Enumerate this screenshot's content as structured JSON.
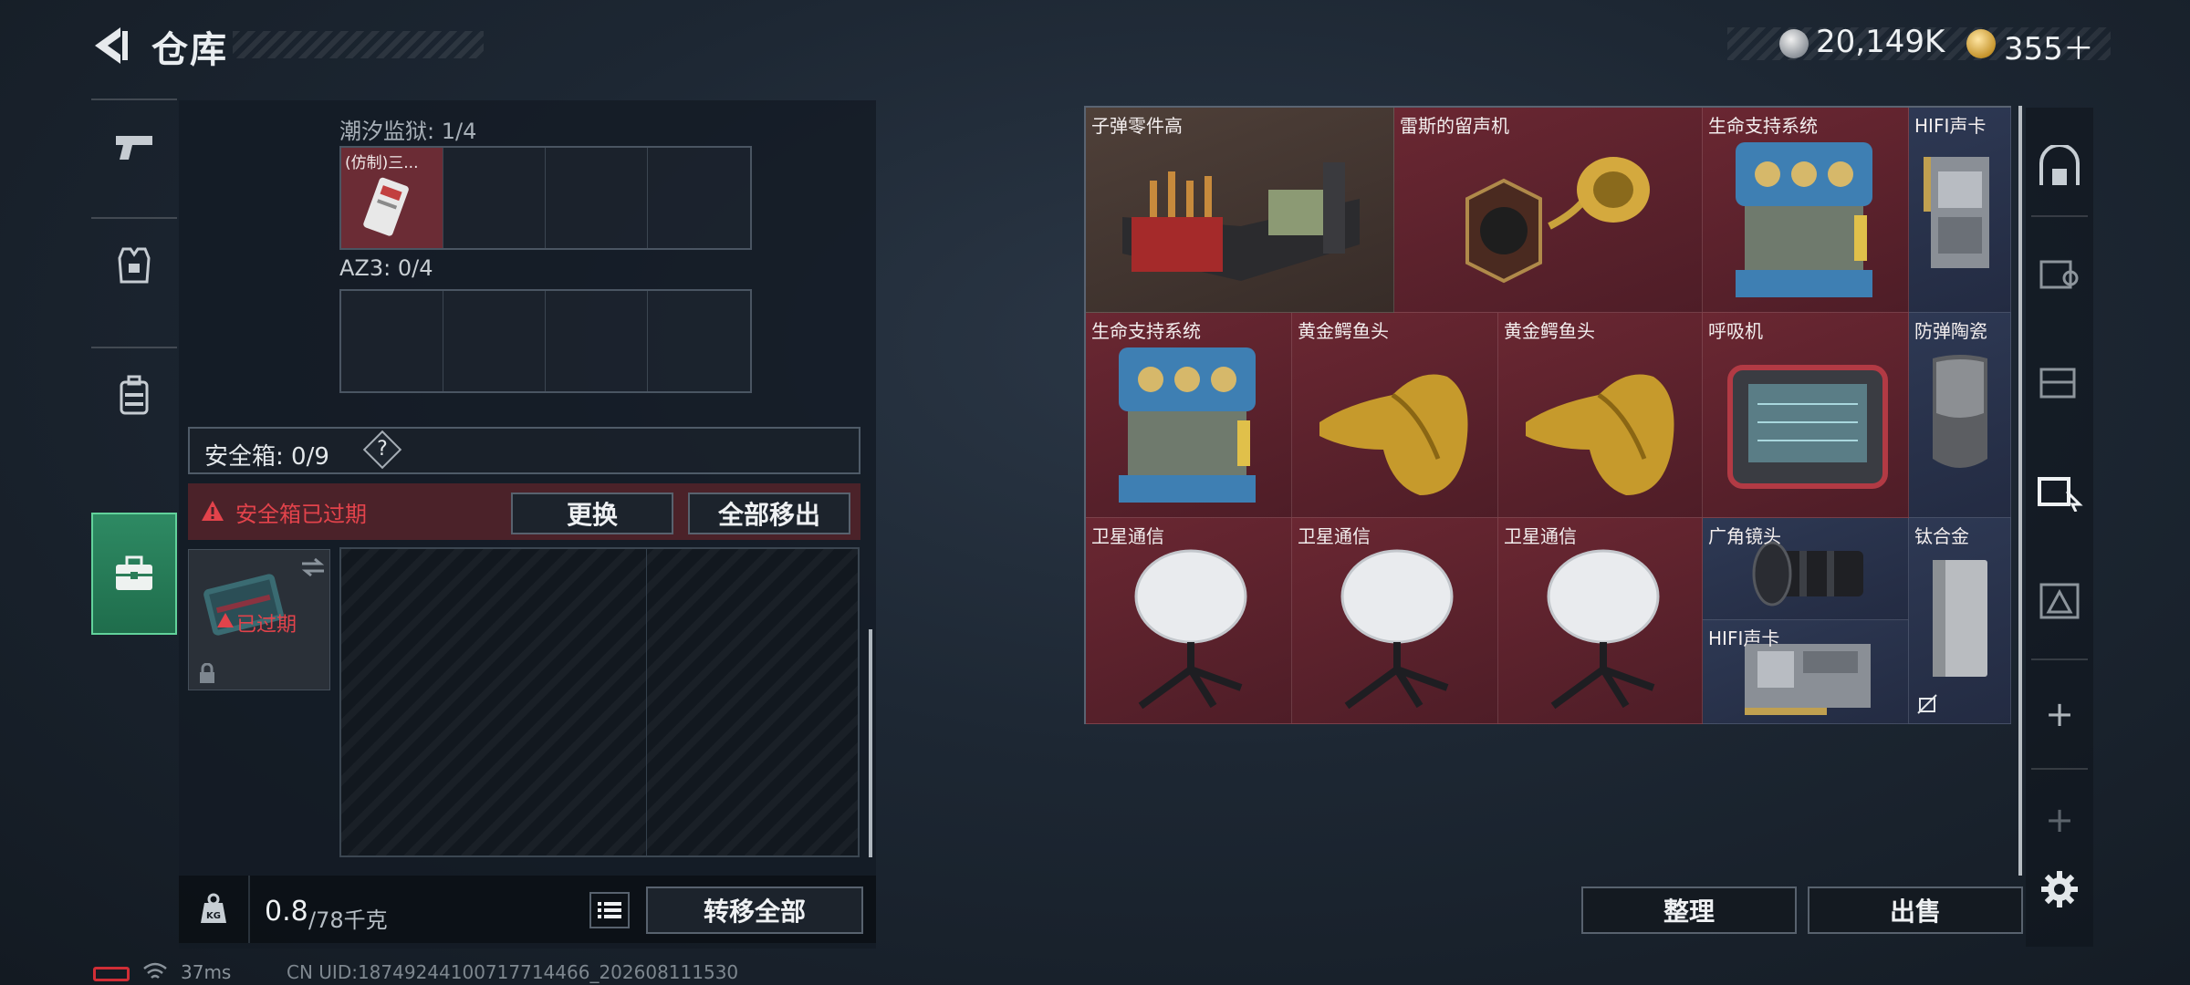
{
  "header": {
    "title": "仓库",
    "currency": [
      {
        "icon": "silver-coin-icon",
        "value": "20,149K"
      },
      {
        "icon": "gold-coin-icon",
        "value": "355＋"
      }
    ]
  },
  "left_tabs": [
    {
      "icon": "pistol-icon",
      "active": false
    },
    {
      "icon": "armor-vest-icon",
      "active": false
    },
    {
      "icon": "backpack-icon",
      "active": false
    },
    {
      "icon": "toolbox-icon",
      "active": true
    }
  ],
  "containers": {
    "tide_prison": {
      "label": "潮汐监狱: 1/4",
      "items": [
        {
          "name": "(仿制)三...",
          "filled": true
        },
        {},
        {},
        {}
      ]
    },
    "az3": {
      "label": "AZ3: 0/4"
    }
  },
  "safebox": {
    "label": "安全箱: 0/9",
    "help": "?",
    "alert_text": "安全箱已过期",
    "replace_button": "更换",
    "remove_all_button": "全部移出",
    "expired_label": "已过期"
  },
  "weight": {
    "current": "0.8",
    "max": "/78千克",
    "icon_label": "KG"
  },
  "transfer_all_button": "转移全部",
  "inventory": {
    "items": [
      {
        "name": "子弹零件高",
        "rarity": "brown",
        "icon": "ammo-crate-icon"
      },
      {
        "name": "雷斯的留声机",
        "rarity": "red",
        "icon": "gramophone-icon"
      },
      {
        "name": "生命支持系统",
        "rarity": "red",
        "icon": "life-support-icon"
      },
      {
        "name": "HIFI声卡",
        "rarity": "blue",
        "icon": "sound-card-icon"
      },
      {
        "name": "生命支持系统",
        "rarity": "red",
        "icon": "life-support-icon"
      },
      {
        "name": "黄金鳄鱼头",
        "rarity": "red",
        "icon": "gold-croc-head-icon"
      },
      {
        "name": "黄金鳄鱼头",
        "rarity": "red",
        "icon": "gold-croc-head-icon"
      },
      {
        "name": "呼吸机",
        "rarity": "red",
        "icon": "ventilator-icon"
      },
      {
        "name": "防弹陶瓷",
        "rarity": "blue",
        "icon": "ceramic-plate-icon"
      },
      {
        "name": "卫星通信",
        "rarity": "red",
        "icon": "satellite-dish-icon"
      },
      {
        "name": "卫星通信",
        "rarity": "red",
        "icon": "satellite-dish-icon"
      },
      {
        "name": "卫星通信",
        "rarity": "red",
        "icon": "satellite-dish-icon"
      },
      {
        "name": "广角镜头",
        "rarity": "blue",
        "icon": "camera-lens-icon"
      },
      {
        "name": "钛合金",
        "rarity": "blue",
        "icon": "titanium-block-icon"
      },
      {
        "name": "HIFI声卡",
        "rarity": "blue",
        "icon": "sound-card-icon"
      }
    ]
  },
  "organize_button": "整理",
  "sell_button": "出售",
  "status": {
    "ping": "37ms",
    "uid": "CN UID:18749244100717714466_202608111530"
  },
  "colors": {
    "accent_green": "#2e8a63",
    "alert_red": "#e2434b",
    "rarity_red": "#6a2732",
    "rarity_blue": "#2e3954"
  }
}
